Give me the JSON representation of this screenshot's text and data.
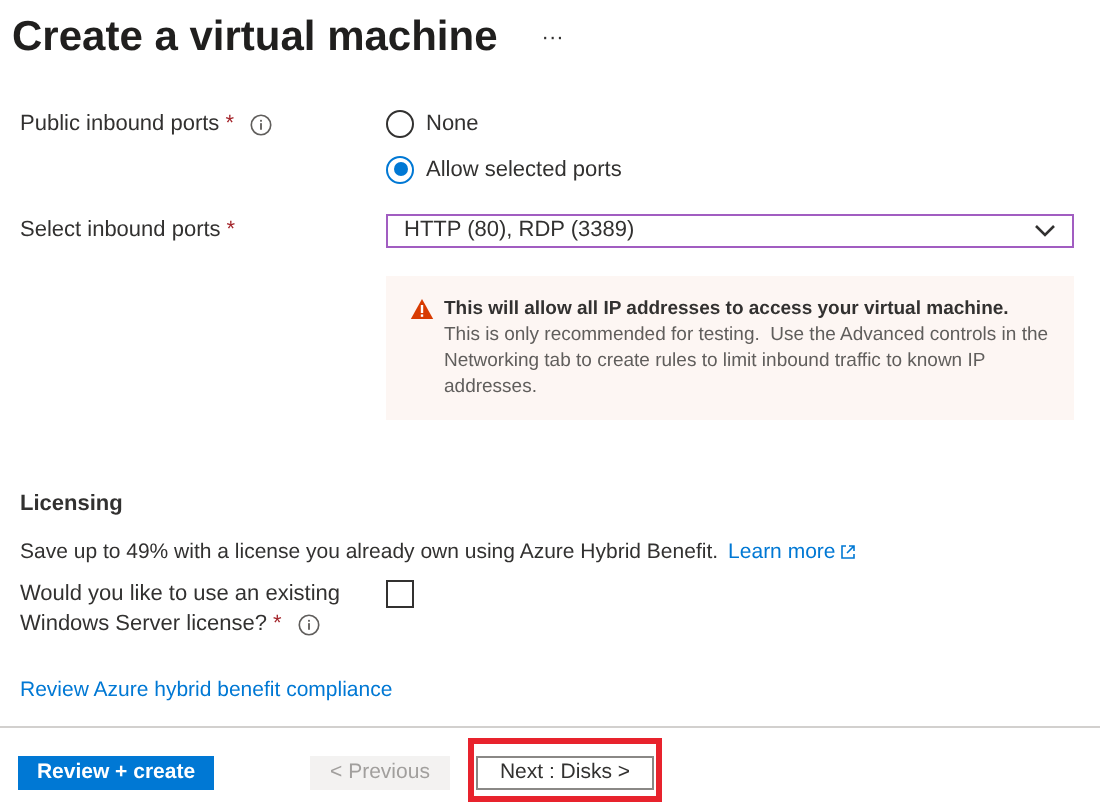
{
  "title": "Create a virtual machine",
  "more_label": "···",
  "public_inbound_ports": {
    "label": "Public inbound ports",
    "required_mark": "*",
    "options": [
      {
        "label": "None",
        "selected": false
      },
      {
        "label": "Allow selected ports",
        "selected": true
      }
    ]
  },
  "select_inbound_ports": {
    "label": "Select inbound ports",
    "required_mark": "*",
    "value": "HTTP (80), RDP (3389)"
  },
  "warning": {
    "bold": "This will allow all IP addresses to access your virtual machine.",
    "text": "This is only recommended for testing.  Use the Advanced controls in the Networking tab to create rules to limit inbound traffic to known IP addresses."
  },
  "licensing": {
    "heading": "Licensing",
    "description": "Save up to 49% with a license you already own using Azure Hybrid Benefit.",
    "learn_more": "Learn more",
    "existing_license": {
      "label_line1": "Would you like to use an existing",
      "label_line2": "Windows Server license?",
      "required_mark": "*",
      "checked": false
    },
    "compliance_link": "Review Azure hybrid benefit compliance"
  },
  "footer": {
    "buttons": [
      {
        "kind": "primary",
        "label": "Review + create",
        "disabled": false,
        "highlighted": false
      },
      {
        "kind": "secondary",
        "label": "< Previous",
        "disabled": true,
        "highlighted": false
      },
      {
        "kind": "secondary",
        "label": "Next : Disks >",
        "disabled": false,
        "highlighted": true
      }
    ]
  }
}
